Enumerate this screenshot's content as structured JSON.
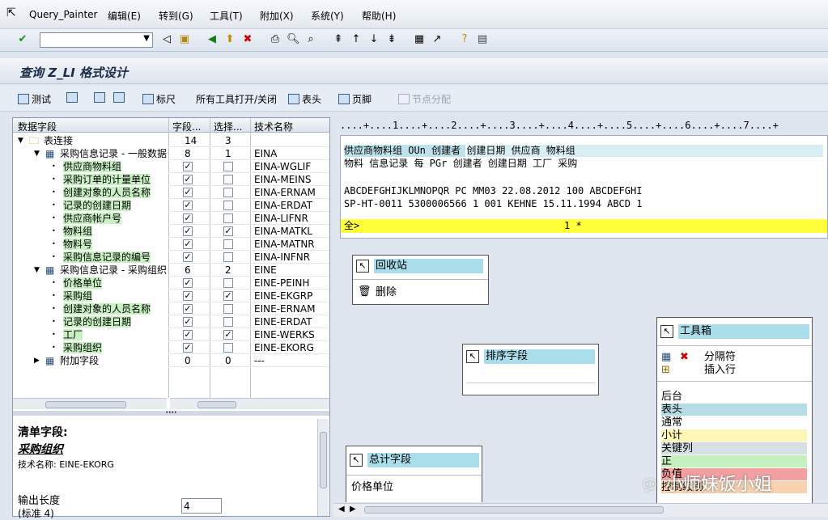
{
  "menu": {
    "app": "Query_Painter",
    "items": [
      "编辑(E)",
      "转到(G)",
      "工具(T)",
      "附加(X)",
      "系统(Y)",
      "帮助(H)"
    ]
  },
  "title": "查询 Z_LI 格式设计",
  "app_toolbar": {
    "test": "测试",
    "ruler": "标尺",
    "all_tools": "所有工具打开/关闭",
    "header": "表头",
    "footer": "页脚",
    "node_alloc": "节点分配"
  },
  "grid": {
    "headers": [
      "数据字段",
      "字段...",
      "选择...",
      "技术名称"
    ],
    "rows": [
      {
        "label": "表连接",
        "c1": "14",
        "c2": "3",
        "tech": "",
        "level": 0,
        "type": "folder"
      },
      {
        "label": "采购信息记录 - 一般数据",
        "c1": "8",
        "c2": "1",
        "tech": "EINA",
        "level": 1,
        "type": "table"
      },
      {
        "label": "供应商物料组",
        "cb1": true,
        "cb2": false,
        "tech": "EINA-WGLIF",
        "level": 2,
        "type": "field"
      },
      {
        "label": "采购订单的计量单位",
        "cb1": true,
        "cb2": false,
        "tech": "EINA-MEINS",
        "level": 2,
        "type": "field"
      },
      {
        "label": "创建对象的人员名称",
        "cb1": true,
        "cb2": false,
        "tech": "EINA-ERNAM",
        "level": 2,
        "type": "field"
      },
      {
        "label": "记录的创建日期",
        "cb1": true,
        "cb2": false,
        "tech": "EINA-ERDAT",
        "level": 2,
        "type": "field"
      },
      {
        "label": "供应商帐户号",
        "cb1": true,
        "cb2": false,
        "tech": "EINA-LIFNR",
        "level": 2,
        "type": "field"
      },
      {
        "label": "物料组",
        "cb1": true,
        "cb2": true,
        "tech": "EINA-MATKL",
        "level": 2,
        "type": "field"
      },
      {
        "label": "物料号",
        "cb1": true,
        "cb2": false,
        "tech": "EINA-MATNR",
        "level": 2,
        "type": "field"
      },
      {
        "label": "采购信息记录的编号",
        "cb1": true,
        "cb2": false,
        "tech": "EINA-INFNR",
        "level": 2,
        "type": "field"
      },
      {
        "label": "采购信息记录 - 采购组织",
        "c1": "6",
        "c2": "2",
        "tech": "EINE",
        "level": 1,
        "type": "table"
      },
      {
        "label": "价格单位",
        "cb1": true,
        "cb2": false,
        "tech": "EINE-PEINH",
        "level": 2,
        "type": "field"
      },
      {
        "label": "采购组",
        "cb1": true,
        "cb2": true,
        "tech": "EINE-EKGRP",
        "level": 2,
        "type": "field"
      },
      {
        "label": "创建对象的人员名称",
        "cb1": true,
        "cb2": false,
        "tech": "EINE-ERNAM",
        "level": 2,
        "type": "field"
      },
      {
        "label": "记录的创建日期",
        "cb1": true,
        "cb2": false,
        "tech": "EINE-ERDAT",
        "level": 2,
        "type": "field"
      },
      {
        "label": "工厂",
        "cb1": true,
        "cb2": true,
        "tech": "EINE-WERKS",
        "level": 2,
        "type": "field"
      },
      {
        "label": "采购组织",
        "cb1": true,
        "cb2": false,
        "tech": "EINE-EKORG",
        "level": 2,
        "type": "field"
      },
      {
        "label": "附加字段",
        "c1": "0",
        "c2": "0",
        "tech": "---",
        "level": 1,
        "type": "extra"
      }
    ]
  },
  "field_info": {
    "heading": "清单字段:",
    "name": "采购组织",
    "tech_label": "技术名称: EINE-EKORG",
    "output_len_label": "输出长度",
    "standard": "(标准 4)",
    "output_len_value": "4"
  },
  "ruler": "....+....1....+....2....+....3....+....4....+....5....+....6....+....7....+",
  "preview": {
    "head1": "供应商物料组      OUn 创建者        创建日期    供应商        物料组",
    "head2": "物料              信息记录     每     PGr 创建者        创建日期     工厂  采购",
    "line1": "ABCDEFGHIJKLMNOPQR PC  MM03          22.08.2012 100          ABCDEFGHI",
    "line2": "SP-HT-0011         5300006566     1   001 KEHNE         15.11.1994 ABCD 1",
    "total_label": "全>",
    "total_value": "1  *"
  },
  "recycle": {
    "title": "回收站",
    "delete": "删除"
  },
  "sort": {
    "title": "排序字段"
  },
  "total_fields": {
    "title": "总计字段",
    "item": "价格单位"
  },
  "toolbox": {
    "title": "工具箱",
    "separator": "分隔符",
    "insert_row": "插入行",
    "kinds": [
      "后台",
      "表头",
      "通常",
      "小计",
      "关键列",
      "正",
      "负值",
      "控制级别"
    ]
  },
  "colors": {
    "toolbox": [
      "#ffffff",
      "#b6dde6",
      "#ffffff",
      "#fff6b5",
      "#d6dfe2",
      "#c6f0c0",
      "#f4a0a0",
      "#f9d2b0"
    ]
  },
  "watermark": "小师妹饭小姐"
}
